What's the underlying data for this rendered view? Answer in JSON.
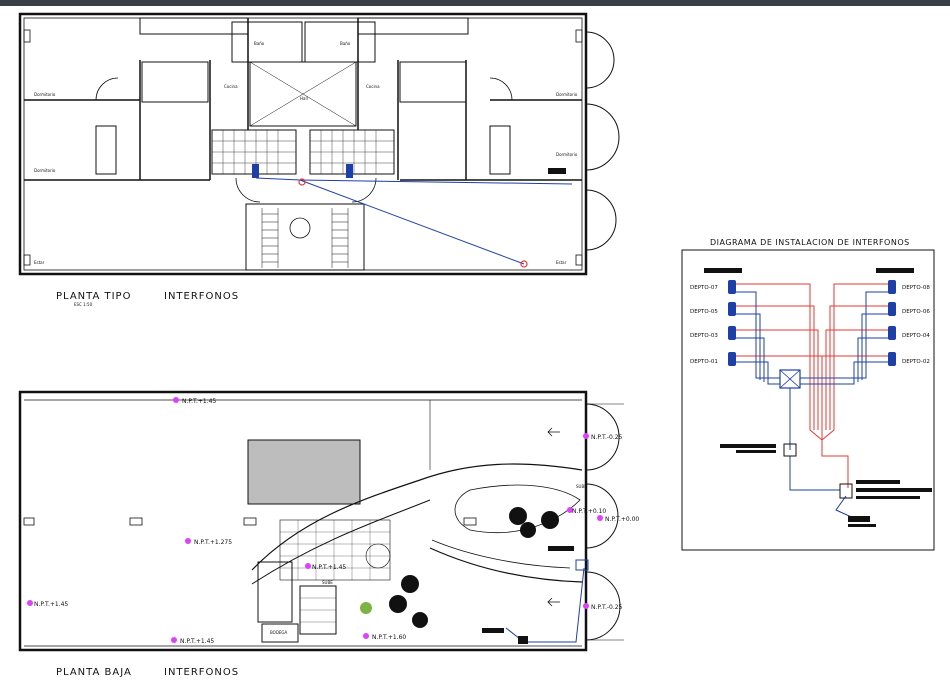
{
  "window": {
    "toolbar_color": "#3a3f46"
  },
  "colors": {
    "background": "#ffffff",
    "line": "#111111",
    "red_wire": "#e53935",
    "blue_wire": "#1e3fa8",
    "level_marker": "#e040fb"
  },
  "plan_top": {
    "title": "PLANTA TIPO",
    "subtitle": "INTERFONOS",
    "scale": "ESC 1:50",
    "rooms": [
      "Dormitorio",
      "Dormitorio",
      "Dormitorio",
      "Dormitorio",
      "Baño",
      "Baño",
      "Hall",
      "Cocina",
      "Cocina",
      "Estar",
      "Estar"
    ]
  },
  "plan_bottom": {
    "title": "PLANTA BAJA",
    "subtitle": "INTERFONOS",
    "levels": [
      "N.P.T.+1.45",
      "N.P.T.+1.275",
      "N.P.T.+1.45",
      "N.P.T.+1.45",
      "N.P.T.+1.45",
      "N.P.T.+1.60",
      "N.P.T.-0.25",
      "N.P.T.+0.00",
      "N.P.T.-0.25",
      "N.P.T.+0.10"
    ],
    "labels": [
      "SUBE",
      "SUBE",
      "BODEGA"
    ]
  },
  "diagram": {
    "title": "DIAGRAMA DE INSTALACION DE INTERFONOS",
    "left_units": [
      "DEPTO-07",
      "DEPTO-05",
      "DEPTO-03",
      "DEPTO-01"
    ],
    "right_units": [
      "DEPTO-08",
      "DEPTO-06",
      "DEPTO-04",
      "DEPTO-02"
    ]
  }
}
